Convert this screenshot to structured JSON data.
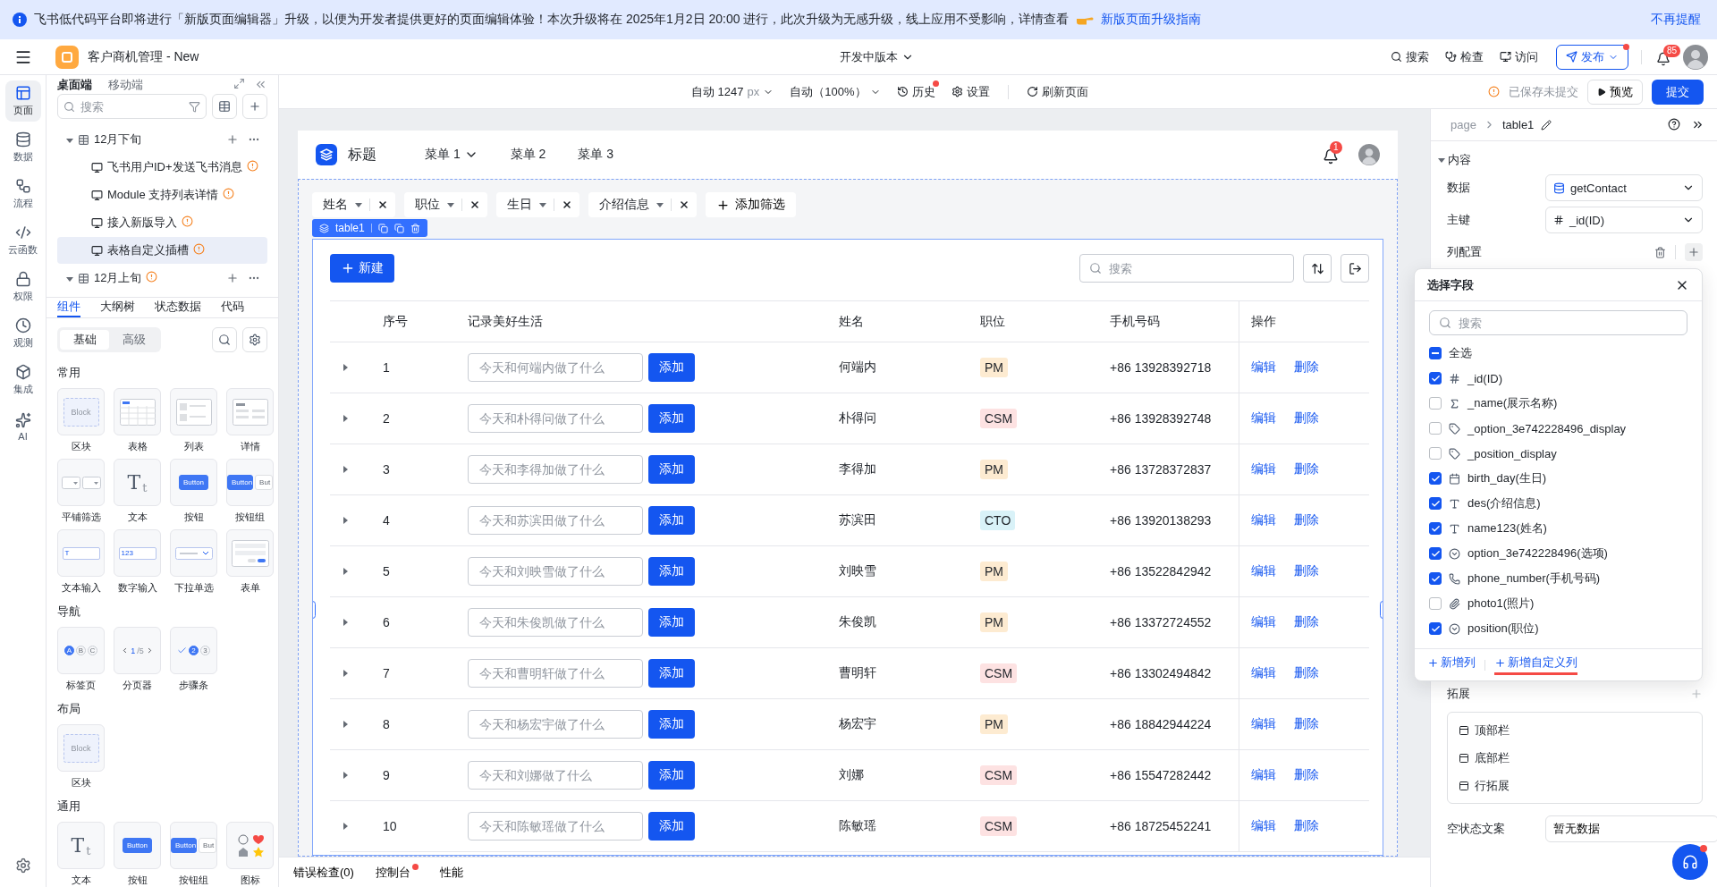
{
  "banner": {
    "text": "飞书低代码平台即将进行「新版页面编辑器」升级，以便为开发者提供更好的页面编辑体验！本次升级将在 2025年1月2日 20:00 进行，此次升级为无感升级，线上应用不受影响，详情查看",
    "link": "新版页面升级指南",
    "dismiss": "不再提醒"
  },
  "header": {
    "app_name": "客户商机管理 - New",
    "version": "开发中版本",
    "actions": [
      {
        "kind": "search",
        "label": "搜索"
      },
      {
        "kind": "inspect",
        "label": "检查"
      },
      {
        "kind": "visit",
        "label": "访问"
      }
    ],
    "publish": {
      "label": "发布",
      "dot": true
    },
    "notifications": "85"
  },
  "rail": {
    "items": [
      {
        "kind": "page",
        "label": "页面",
        "selected": true
      },
      {
        "kind": "data",
        "label": "数据",
        "selected": false
      },
      {
        "kind": "flow",
        "label": "流程",
        "selected": false
      },
      {
        "kind": "function",
        "label": "云函数",
        "selected": false
      },
      {
        "kind": "permission",
        "label": "权限",
        "selected": false
      },
      {
        "kind": "observe",
        "label": "观测",
        "selected": false
      },
      {
        "kind": "integration",
        "label": "集成",
        "selected": false
      },
      {
        "kind": "ai",
        "label": "AI",
        "selected": false
      }
    ]
  },
  "left_panel": {
    "tabs": [
      {
        "label": "桌面端",
        "selected": true
      },
      {
        "label": "移动端",
        "selected": false
      }
    ],
    "search": {
      "placeholder": "搜索"
    },
    "tree": [
      {
        "label": "12月下旬",
        "warning": false,
        "expanded": true,
        "children": [
          {
            "label": "飞书用户ID+发送飞书消息",
            "warning": true,
            "selected": false
          },
          {
            "label": "Module 支持列表详情",
            "warning": true,
            "selected": false
          },
          {
            "label": "接入新版导入",
            "warning": true,
            "selected": false
          },
          {
            "label": "表格自定义插槽",
            "warning": true,
            "selected": true
          }
        ]
      },
      {
        "label": "12月上旬",
        "warning": true,
        "expanded": true
      }
    ],
    "component_tabs": [
      {
        "label": "组件",
        "selected": true
      },
      {
        "label": "大纲树",
        "selected": false
      },
      {
        "label": "状态数据",
        "selected": false
      },
      {
        "label": "代码",
        "selected": false
      }
    ],
    "segments": [
      {
        "label": "基础",
        "selected": true
      },
      {
        "label": "高级",
        "selected": false
      }
    ],
    "sections": [
      {
        "title": "常用",
        "items": [
          {
            "label": "区块",
            "kind": "block",
            "preview": [
              "Block"
            ]
          },
          {
            "label": "表格",
            "kind": "table"
          },
          {
            "label": "列表",
            "kind": "list"
          },
          {
            "label": "详情",
            "kind": "detail"
          },
          {
            "label": "平铺筛选",
            "kind": "filter"
          },
          {
            "label": "文本",
            "kind": "text",
            "preview": [
              "T",
              "t"
            ]
          },
          {
            "label": "按钮",
            "kind": "button",
            "preview": [
              "Button"
            ]
          },
          {
            "label": "按钮组",
            "kind": "button_group",
            "preview": [
              "Button",
              "But"
            ]
          },
          {
            "label": "文本输入",
            "kind": "text_input",
            "preview": [
              "T"
            ]
          },
          {
            "label": "数字输入",
            "kind": "number_input",
            "preview": [
              "123"
            ]
          },
          {
            "label": "下拉单选",
            "kind": "select"
          },
          {
            "label": "表单",
            "kind": "form"
          }
        ]
      },
      {
        "title": "导航",
        "items": [
          {
            "label": "标签页",
            "kind": "tabs",
            "preview": [
              "A",
              "B",
              "C"
            ]
          },
          {
            "label": "分页器",
            "kind": "pagination",
            "preview": [
              "1",
              "/5"
            ]
          },
          {
            "label": "步骤条",
            "kind": "steps",
            "preview": [
              "2",
              "3"
            ]
          }
        ]
      },
      {
        "title": "布局",
        "items": [
          {
            "label": "区块",
            "kind": "block",
            "preview": [
              "Block"
            ]
          }
        ]
      },
      {
        "title": "通用",
        "items": [
          {
            "label": "文本",
            "kind": "text",
            "preview": [
              "T",
              "t"
            ]
          },
          {
            "label": "按钮",
            "kind": "button",
            "preview": [
              "Button"
            ]
          },
          {
            "label": "按钮组",
            "kind": "button_group",
            "preview": [
              "Button",
              "But"
            ]
          },
          {
            "label": "图标",
            "kind": "icon"
          }
        ]
      }
    ]
  },
  "toolbar": {
    "width": "自动 1247",
    "unit": "px",
    "zoom": "自动（100%）",
    "history": {
      "label": "历史",
      "dot": true
    },
    "settings": "设置",
    "refresh": "刷新页面",
    "status": "已保存未提交",
    "preview": "预览",
    "submit": "提交"
  },
  "canvas": {
    "app_header": {
      "title": "标题",
      "menus": [
        {
          "label": "菜单 1",
          "dropdown": true
        },
        {
          "label": "菜单 2",
          "dropdown": false
        },
        {
          "label": "菜单 3",
          "dropdown": false
        }
      ],
      "badge": "1"
    },
    "filters": [
      {
        "label": "姓名"
      },
      {
        "label": "职位"
      },
      {
        "label": "生日"
      },
      {
        "label": "介绍信息"
      }
    ],
    "add_filter": "添加筛选",
    "selection_tag": "table1",
    "table": {
      "new_button": "新建",
      "search": {
        "placeholder": "搜索"
      },
      "columns": [
        "序号",
        "记录美好生活",
        "姓名",
        "职位",
        "手机号码",
        "操作"
      ],
      "rows": [
        {
          "index": "1",
          "placeholder": "今天和何端内做了什么",
          "add": "添加",
          "name": "何端内",
          "position": "PM",
          "color": "#fdebd1",
          "phone": "+86 13928392718",
          "actions": [
            "编辑",
            "删除"
          ]
        },
        {
          "index": "2",
          "placeholder": "今天和朴得问做了什么",
          "add": "添加",
          "name": "朴得问",
          "position": "CSM",
          "color": "#fde2e2",
          "phone": "+86 13928392748",
          "actions": [
            "编辑",
            "删除"
          ]
        },
        {
          "index": "3",
          "placeholder": "今天和李得加做了什么",
          "add": "添加",
          "name": "李得加",
          "position": "PM",
          "color": "#fdebd1",
          "phone": "+86 13728372837",
          "actions": [
            "编辑",
            "删除"
          ]
        },
        {
          "index": "4",
          "placeholder": "今天和苏滨田做了什么",
          "add": "添加",
          "name": "苏滨田",
          "position": "CTO",
          "color": "#d9f2f8",
          "phone": "+86 13920138293",
          "actions": [
            "编辑",
            "删除"
          ]
        },
        {
          "index": "5",
          "placeholder": "今天和刘映雪做了什么",
          "add": "添加",
          "name": "刘映雪",
          "position": "PM",
          "color": "#fdebd1",
          "phone": "+86 13522842942",
          "actions": [
            "编辑",
            "删除"
          ]
        },
        {
          "index": "6",
          "placeholder": "今天和朱俊凯做了什么",
          "add": "添加",
          "name": "朱俊凯",
          "position": "PM",
          "color": "#fdebd1",
          "phone": "+86 13372724552",
          "actions": [
            "编辑",
            "删除"
          ]
        },
        {
          "index": "7",
          "placeholder": "今天和曹明轩做了什么",
          "add": "添加",
          "name": "曹明轩",
          "position": "CSM",
          "color": "#fde2e2",
          "phone": "+86 13302494842",
          "actions": [
            "编辑",
            "删除"
          ]
        },
        {
          "index": "8",
          "placeholder": "今天和杨宏宇做了什么",
          "add": "添加",
          "name": "杨宏宇",
          "position": "PM",
          "color": "#fdebd1",
          "phone": "+86 18842944224",
          "actions": [
            "编辑",
            "删除"
          ]
        },
        {
          "index": "9",
          "placeholder": "今天和刘娜做了什么",
          "add": "添加",
          "name": "刘娜",
          "position": "CSM",
          "color": "#fde2e2",
          "phone": "+86 15547282442",
          "actions": [
            "编辑",
            "删除"
          ]
        },
        {
          "index": "10",
          "placeholder": "今天和陈敏瑶做了什么",
          "add": "添加",
          "name": "陈敏瑶",
          "position": "CSM",
          "color": "#fde2e2",
          "phone": "+86 18725452241",
          "actions": [
            "编辑",
            "删除"
          ]
        }
      ]
    }
  },
  "bottom_bar": {
    "tabs": [
      {
        "label": "错误检查(0)",
        "dot": false
      },
      {
        "label": "控制台",
        "dot": true
      },
      {
        "label": "性能",
        "dot": false
      }
    ]
  },
  "right_panel": {
    "breadcrumb": [
      "page",
      "table1"
    ],
    "section": "内容",
    "data": {
      "label": "数据",
      "value": "getContact"
    },
    "primary_key": {
      "label": "主键",
      "value": "_id(ID)"
    },
    "column_config": "列配置",
    "field_picker": {
      "title": "选择字段",
      "search": {
        "placeholder": "搜索"
      },
      "select_all": {
        "label": "全选",
        "partial": true
      },
      "fields": [
        {
          "label": "_id(ID)",
          "kind": "number",
          "checked": true
        },
        {
          "label": "_name(展示名称)",
          "kind": "formula",
          "checked": false
        },
        {
          "label": "_option_3e742228496_display",
          "kind": "tag",
          "checked": false
        },
        {
          "label": "_position_display",
          "kind": "tag",
          "checked": false
        },
        {
          "label": "birth_day(生日)",
          "kind": "date",
          "checked": true
        },
        {
          "label": "des(介绍信息)",
          "kind": "text",
          "checked": true
        },
        {
          "label": "name123(姓名)",
          "kind": "text",
          "checked": true
        },
        {
          "label": "option_3e742228496(选项)",
          "kind": "option",
          "checked": true
        },
        {
          "label": "phone_number(手机号码)",
          "kind": "phone",
          "checked": true
        },
        {
          "label": "photo1(照片)",
          "kind": "attachment",
          "checked": false
        },
        {
          "label": "position(职位)",
          "kind": "option",
          "checked": true
        }
      ],
      "footer": [
        {
          "label": "新增列",
          "underlined": false
        },
        {
          "label": "新增自定义列",
          "underlined": true
        }
      ]
    },
    "extension": {
      "title": "拓展",
      "items": [
        "顶部栏",
        "底部栏",
        "行拓展"
      ]
    },
    "empty_text": {
      "label": "空状态文案",
      "value": "暂无数据"
    }
  }
}
